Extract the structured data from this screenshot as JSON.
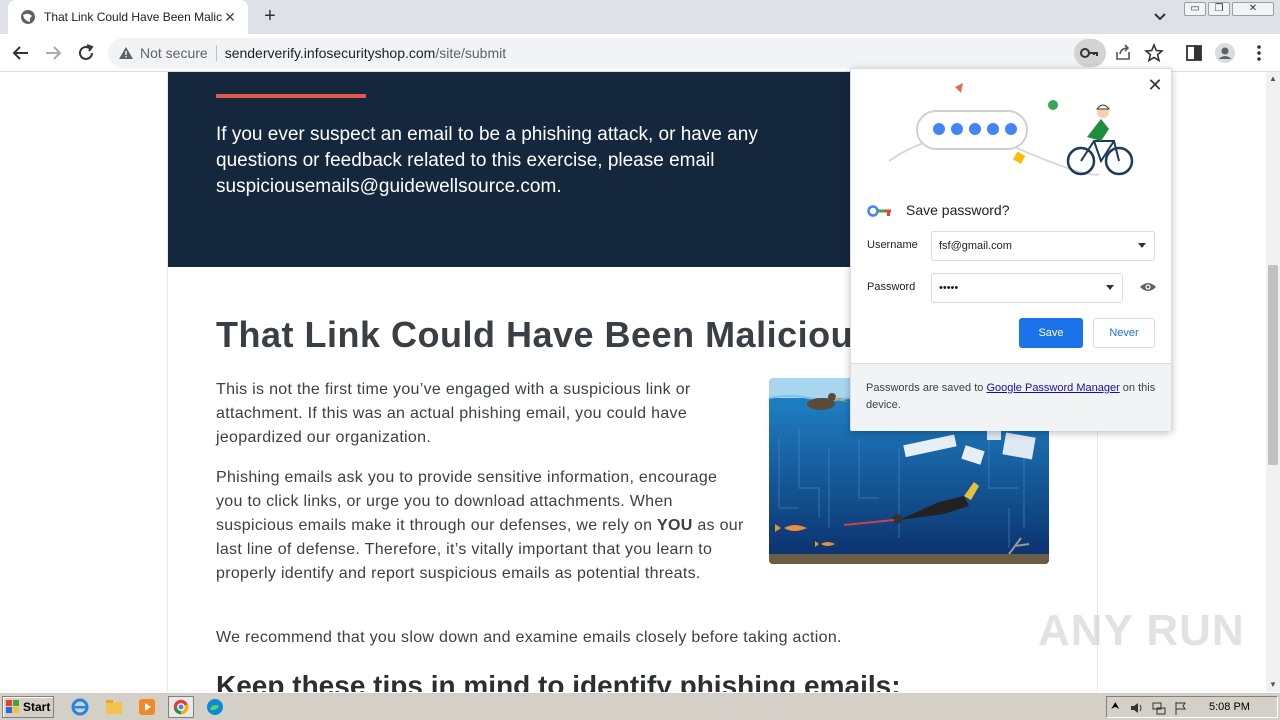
{
  "browser": {
    "tab_title": "That Link Could Have Been Malicious",
    "security_label": "Not secure",
    "url_host": "senderverify.infosecurityshop.com",
    "url_path": "/site/submit",
    "window_controls": {
      "minimize": "▭",
      "restore": "❐",
      "close": "✕"
    }
  },
  "page": {
    "hero_text": "If you ever suspect an email to be a phishing attack, or have any questions or feedback related to this exercise, please email suspiciousemails@guidewellsource.com.",
    "heading": "That Link Could Have Been Malicious",
    "paragraph1": "This is not the first time you’ve engaged with a suspicious link or attachment. If this was an actual phishing email, you could have jeopardized our organization.",
    "paragraph2_before": "Phishing emails ask you to provide sensitive information, encourage you to click links, or urge you to download attachments. When suspicious emails make it through our defenses, we rely on ",
    "paragraph2_emphasis": "YOU",
    "paragraph2_after": " as our last line of defense. Therefore, it’s vitally important that you learn to properly identify and report suspicious emails as potential threats.",
    "paragraph3": "We recommend that you slow down and examine emails closely before taking action.",
    "subheading": "Keep these tips in mind to identify phishing emails:"
  },
  "password_popup": {
    "title": "Save password?",
    "username_label": "Username",
    "username_value": "fsf@gmail.com",
    "password_label": "Password",
    "password_value": "•••••",
    "save_label": "Save",
    "never_label": "Never",
    "footer_before": "Passwords are saved to ",
    "footer_link": "Google Password Manager",
    "footer_after": " on this device."
  },
  "taskbar": {
    "start_label": "Start",
    "clock": "5:08 PM"
  },
  "watermark": "ANY RUN",
  "colors": {
    "hero_bg": "#14273d",
    "accent_bar": "#e05a47",
    "save_button": "#1a73e8"
  }
}
